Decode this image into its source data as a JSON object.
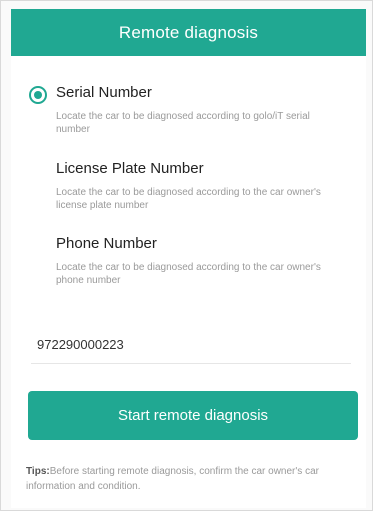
{
  "header": {
    "title": "Remote diagnosis"
  },
  "options": [
    {
      "title": "Serial Number",
      "description": "Locate the car to be diagnosed according to golo/iT serial number",
      "selected": true
    },
    {
      "title": "License Plate Number",
      "description": "Locate the car to be diagnosed according to the car owner's license plate number",
      "selected": false
    },
    {
      "title": "Phone Number",
      "description": "Locate the car to be diagnosed according to the car owner's phone number",
      "selected": false
    }
  ],
  "input": {
    "value": "972290000223"
  },
  "start_button": {
    "label": "Start remote diagnosis"
  },
  "tips": {
    "prefix": "Tips:",
    "text": "Before starting remote diagnosis, confirm the car owner's car information and condition."
  },
  "colors": {
    "accent": "#20a892"
  }
}
